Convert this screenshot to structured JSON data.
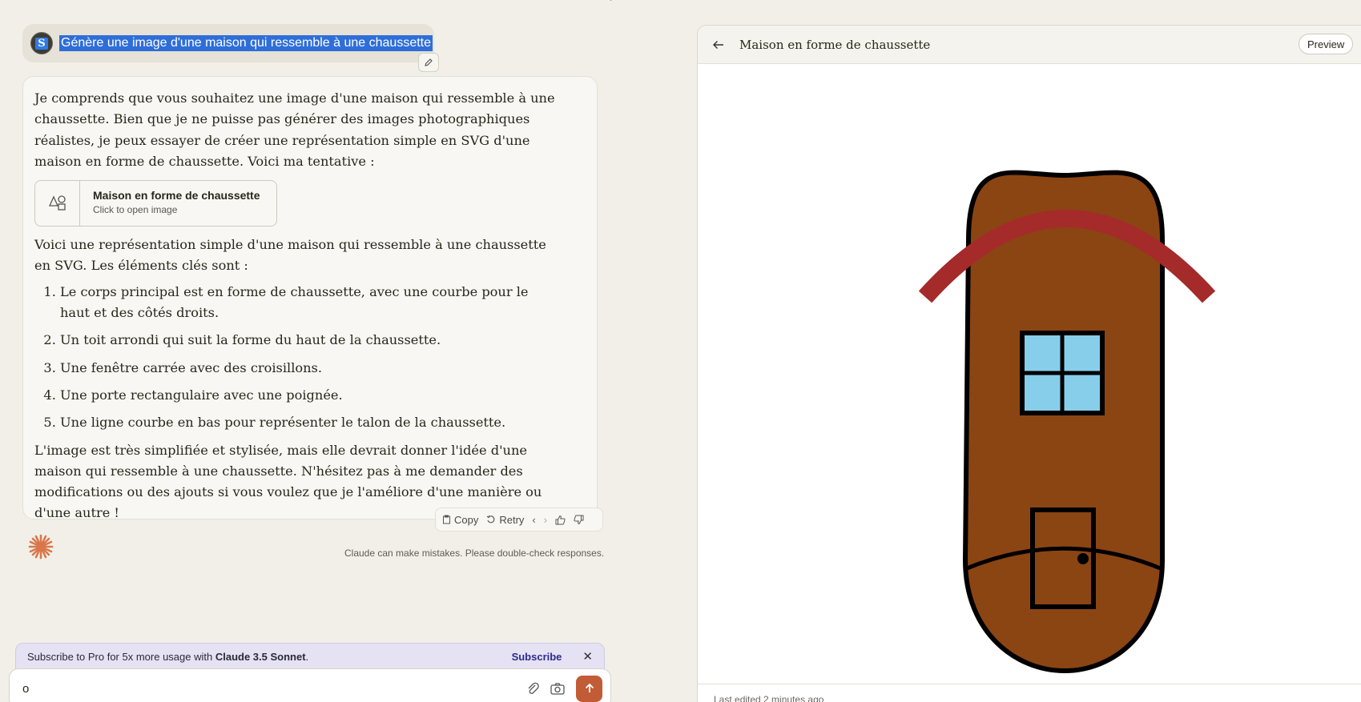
{
  "user_message": {
    "avatar_letter": "S",
    "text": "Génère une image d'une maison qui ressemble à une chaussette"
  },
  "assistant": {
    "intro": "Je comprends que vous souhaitez une image d'une maison qui ressemble à une chaussette. Bien que je ne puisse pas générer des images photographiques réalistes, je peux essayer de créer une représentation simple en SVG d'une maison en forme de chaussette. Voici ma tentative :",
    "artifact_card": {
      "title": "Maison en forme de chaussette",
      "subtitle": "Click to open image"
    },
    "elements_intro": "Voici une représentation simple d'une maison qui ressemble à une chaussette en SVG. Les éléments clés sont :",
    "list": [
      "Le corps principal est en forme de chaussette, avec une courbe pour le haut et des côtés droits.",
      "Un toit arrondi qui suit la forme du haut de la chaussette.",
      "Une fenêtre carrée avec des croisillons.",
      "Une porte rectangulaire avec une poignée.",
      "Une ligne courbe en bas pour représenter le talon de la chaussette."
    ],
    "closing": "L'image est très simplifiée et stylisée, mais elle devrait donner l'idée d'une maison qui ressemble à une chaussette. N'hésitez pas à me demander des modifications ou des ajouts si vous voulez que je l'améliore d'une manière ou d'une autre !"
  },
  "actions": {
    "copy_label": "Copy",
    "retry_label": "Retry"
  },
  "disclaimer": "Claude can make mistakes. Please double-check responses.",
  "subscribe": {
    "text_prefix": "Subscribe to Pro for 5x more usage with ",
    "text_bold": "Claude 3.5 Sonnet",
    "text_suffix": ".",
    "link_label": "Subscribe"
  },
  "input": {
    "value": "o"
  },
  "panel": {
    "title": "Maison en forme de chaussette",
    "preview_label": "Preview",
    "last_edited": "Last edited 2 minutes ago"
  },
  "colors": {
    "accent": "#c25c36",
    "sock_body": "#8b4513",
    "roof": "#a52a2a",
    "window_glass": "#87ceeb"
  }
}
